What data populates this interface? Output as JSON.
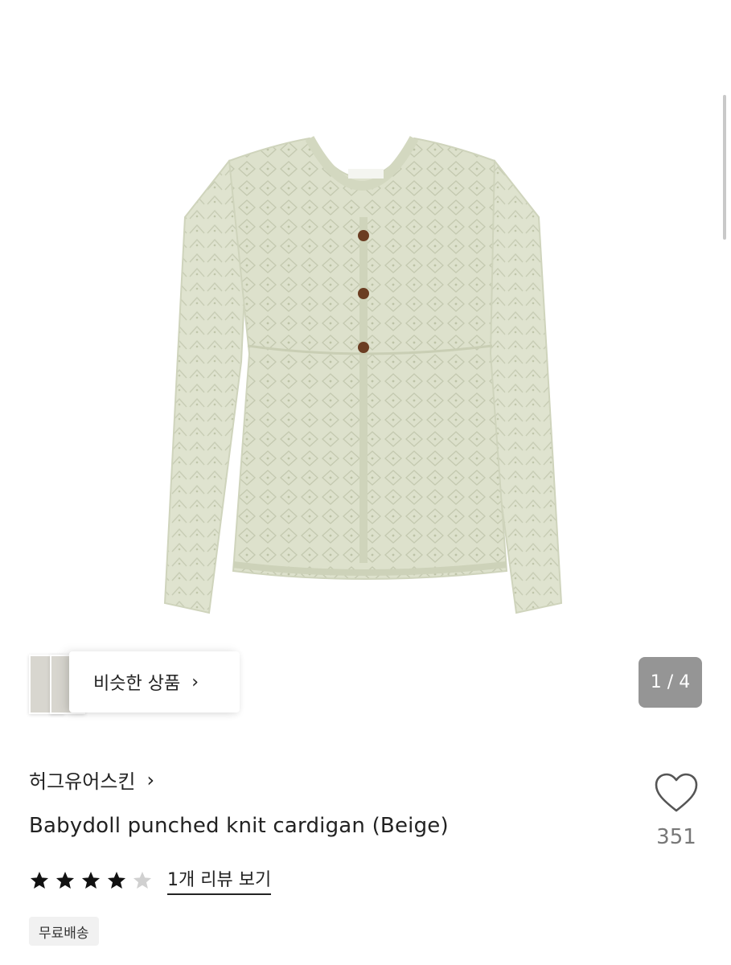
{
  "gallery": {
    "similar_label": "비슷한 상품",
    "counter": "1 / 4",
    "image_alt": "Babydoll punched knit cardigan (Beige)"
  },
  "shop": {
    "name": "허그유어스킨"
  },
  "product": {
    "title": "Babydoll punched knit cardigan (Beige)",
    "rating": 4,
    "rating_max": 5,
    "review_link": "1개 리뷰 보기",
    "badge": "무료배송"
  },
  "like": {
    "count": "351"
  },
  "colors": {
    "knit": "#dfe3cf",
    "button": "#6b3d22",
    "star_filled": "#111111",
    "star_empty": "#d0d0d0",
    "counter_bg": "#8a8a8a"
  }
}
